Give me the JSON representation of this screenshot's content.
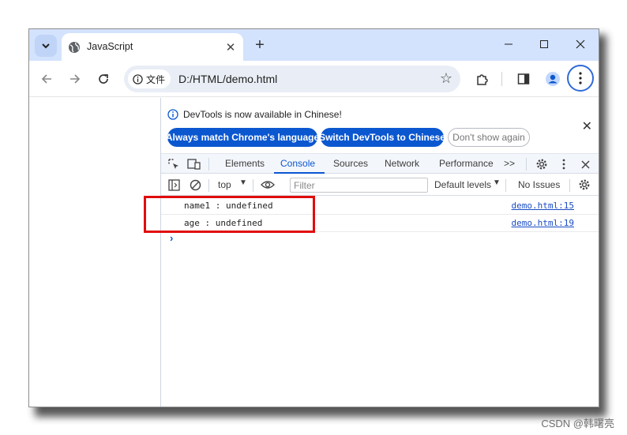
{
  "browser": {
    "tab_title": "JavaScript",
    "chip_label": "文件",
    "url": "D:/HTML/demo.html"
  },
  "devtools": {
    "info_text": "DevTools is now available in Chinese!",
    "btn_match": "Always match Chrome's language",
    "btn_switch": "Switch DevTools to Chinese",
    "btn_dont_show": "Don't show again",
    "tabs": [
      "Elements",
      "Console",
      "Sources",
      "Network",
      "Performance"
    ],
    "active_tab": "Console",
    "more_tabs": ">>",
    "context": "top",
    "filter_placeholder": "Filter",
    "levels": "Default levels",
    "issues": "No Issues"
  },
  "console": {
    "logs": [
      {
        "message": "name1 : undefined",
        "source": "demo.html:15"
      },
      {
        "message": "age : undefined",
        "source": "demo.html:19"
      }
    ],
    "prompt": "›"
  },
  "watermark": "CSDN @韩曙亮",
  "colors": {
    "accent": "#0b57d0",
    "highlight": "#e10c0c",
    "tabstrip": "#d3e3fd"
  }
}
